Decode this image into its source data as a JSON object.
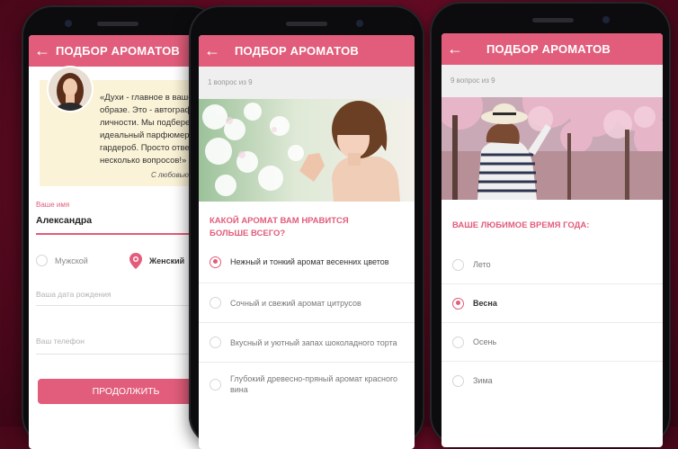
{
  "colors": {
    "accent": "#e15d7b",
    "background": "#6d0d28",
    "quote_bg": "#fbf3d7"
  },
  "screen1": {
    "title": "ПОДБОР АРОМАТОВ",
    "quote": "«Духи - главное в вашем образе. Это - автограф личности. Мы подберем Вам идеальный парфюмерный гардероб. Просто ответьте на несколько вопросов!»",
    "signature": "С любовью,",
    "name_label": "Ваше имя",
    "name_value": "Александра",
    "gender_male": "Мужской",
    "gender_female": "Женский",
    "gender_selected": "Женский",
    "birthdate_placeholder": "Ваша дата рождения",
    "phone_placeholder": "Ваш телефон",
    "continue_button": "ПРОДОЛЖИТЬ"
  },
  "screen2": {
    "title": "ПОДБОР АРОМАТОВ",
    "progress": "1 вопрос из 9",
    "question": "КАКОЙ АРОМАТ ВАМ НРАВИТСЯ БОЛЬШЕ ВСЕГО?",
    "options": [
      "Нежный и тонкий аромат весенних цветов",
      "Сочный и свежий аромат цитрусов",
      "Вкусный и уютный запах шоколадного торта",
      "Глубокий древесно-пряный аромат красного вина"
    ],
    "selected": "Нежный и тонкий аромат весенних цветов"
  },
  "screen3": {
    "title": "ПОДБОР АРОМАТОВ",
    "progress": "9 вопрос из 9",
    "question": "ВАШЕ ЛЮБИМОЕ ВРЕМЯ ГОДА:",
    "options": [
      "Лето",
      "Весна",
      "Осень",
      "Зима"
    ],
    "selected": "Весна"
  }
}
